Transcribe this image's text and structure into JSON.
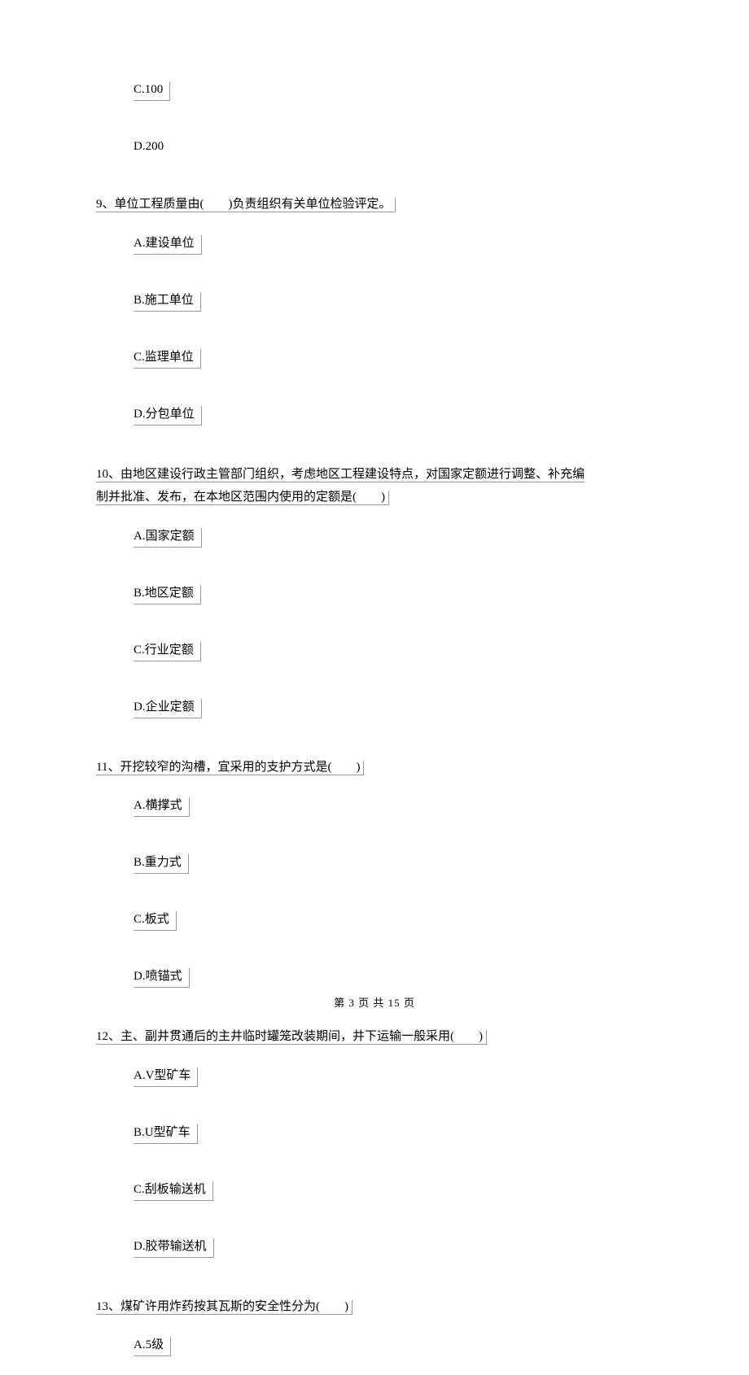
{
  "q8_options": {
    "c": "C.100",
    "d": "D.200"
  },
  "q9": {
    "text": "9、单位工程质量由(　　)负责组织有关单位检验评定。",
    "options": {
      "a": "A.建设单位",
      "b": "B.施工单位",
      "c": "C.监理单位",
      "d": "D.分包单位"
    }
  },
  "q10": {
    "line1": "10、由地区建设行政主管部门组织，考虑地区工程建设特点，对国家定额进行调整、补充编",
    "line2": "制并批准、发布，在本地区范围内使用的定额是(　　)",
    "options": {
      "a": "A.国家定额",
      "b": "B.地区定额",
      "c": "C.行业定额",
      "d": "D.企业定额"
    }
  },
  "q11": {
    "text": "11、开挖较窄的沟槽，宜采用的支护方式是(　　)",
    "options": {
      "a": "A.横撑式",
      "b": "B.重力式",
      "c": "C.板式",
      "d": "D.喷锚式"
    }
  },
  "q12": {
    "text": "12、主、副井贯通后的主井临时罐笼改装期间，井下运输一般采用(　　)",
    "options": {
      "a": "A.V型矿车",
      "b": "B.U型矿车",
      "c": "C.刮板输送机",
      "d": "D.胶带输送机"
    }
  },
  "q13": {
    "text": "13、煤矿许用炸药按其瓦斯的安全性分为(　　)",
    "options": {
      "a": "A.5级"
    }
  },
  "footer": "第 3 页 共 15 页"
}
